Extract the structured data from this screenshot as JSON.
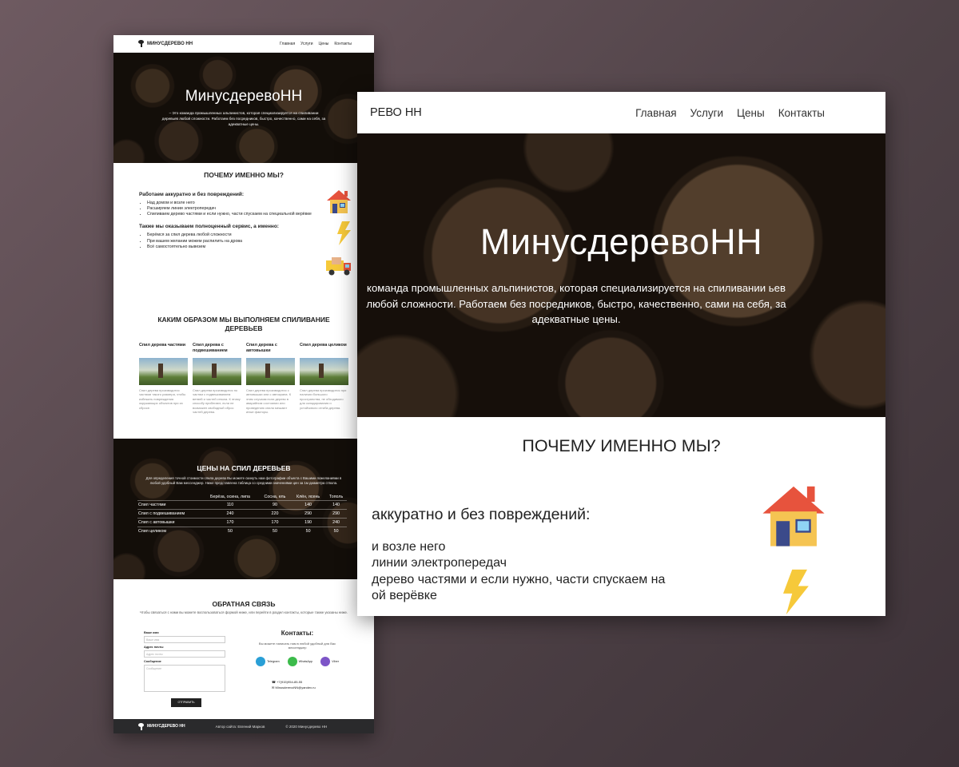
{
  "site": {
    "logo_text": "МИНУСДЕРЕВО НН",
    "nav": [
      "Главная",
      "Услуги",
      "Цены",
      "Контакты"
    ],
    "hero_title": "МинусдеревоНН",
    "hero_text": "– Это команда промышленных альпинистов, которая специализируется на спиливании деревьев любой сложности. Работаем без посредников, быстро, качественно, сами на себя, за адекватные цены."
  },
  "why": {
    "title": "ПОЧЕМУ ИМЕННО МЫ?",
    "block1_title": "Работаем аккуратно и без повреждений:",
    "block1_items": [
      "Над домом и возле него",
      "Расширяем линии электропередач",
      "Спиливаем дерево частями и если нужно, части спускаем на специальной верёвке"
    ],
    "block2_title": "Также мы оказываем полноценный сервис, а именно:",
    "block2_items": [
      "Берёмся за спил дерева любой сложности",
      "При вашем желании можем распилить на дрова",
      "Всё самостоятельно вывезем"
    ],
    "icons": [
      "house-icon",
      "lightning-icon",
      "truck-icon"
    ]
  },
  "how": {
    "title": "КАКИМ ОБРАЗОМ МЫ ВЫПОЛНЯЕМ СПИЛИВАНИЕ ДЕРЕВЬЕВ",
    "cards": [
      {
        "title": "Спил дерева частями",
        "text": "Спил дерева производится частями такого размера, чтобы избежать повреждения окружающих объектов при их сбросе."
      },
      {
        "title": "Спил дерева с подвешиванием",
        "text": "Спил дерева производится по частям с подвешиванием ветвей и частей ствола. К этому способу прибегают, если не возможен свободный сброс частей дерева."
      },
      {
        "title": "Спил дерева с автовышки",
        "text": "Спил дерева производится с автовышки или с автокрана. К этим случаям если дерево в аварийном состоянии или проведению спила мешают иные факторы."
      },
      {
        "title": "Спил дерева целиком",
        "text": "Спил дерева производится при наличии большого пространства, не обходимого для складирования и устойчивого отгиба дерева."
      }
    ]
  },
  "prices": {
    "title": "ЦЕНЫ НА СПИЛ ДЕРЕВЬЕВ",
    "desc": "Для определения точной стоимости спила дерева Вы можете скинуть нам фотографии объекта с Вашими пожеланиями в любой удобный Вам мессенджер. Ниже представлена таблица со средними значениями цен за 1м диаметра ствола.",
    "headers": [
      "",
      "Берёза, осина, липа",
      "Сосна, ель",
      "Клён, ясень",
      "Тополь"
    ],
    "rows": [
      [
        "Спил частями",
        "110",
        "90",
        "140",
        "140"
      ],
      [
        "Спил с подвешиванием",
        "240",
        "220",
        "290",
        "290"
      ],
      [
        "Спил с автовышки",
        "170",
        "170",
        "190",
        "240"
      ],
      [
        "Спил целиком",
        "50",
        "50",
        "50",
        "50"
      ]
    ]
  },
  "feedback": {
    "title": "ОБРАТНАЯ СВЯЗЬ",
    "desc": "Чтобы связаться с нами вы можете воспользоваться формой ниже, или перейти в раздел контакты, которые также указаны ниже.",
    "name_label": "Ваше имя",
    "name_placeholder": "Ваше имя",
    "email_label": "Адрес почты",
    "email_placeholder": "Адрес почты",
    "message_label": "Сообщение",
    "message_placeholder": "Сообщение",
    "submit": "ОТПРАВИТЬ",
    "contacts_title": "Контакты:",
    "contacts_desc": "Вы можете написать нам в любой удобный для Вас мессенджер",
    "messengers": [
      "Telegram",
      "WhatsApp",
      "Viber"
    ],
    "phone": "+7(915)954-85-55",
    "email": "MinusderevoNN@yandex.ru"
  },
  "footer": {
    "logo": "МИНУСДЕРЕВО НН",
    "author": "Автор сайта: Евгений Марков",
    "copyright": "© 2020 Минусдерево НН"
  },
  "zoom": {
    "logo_text_visible": "РЕВО НН",
    "hero_text_visible": "команда промышленных альпинистов, которая специализируется на спиливании ьев любой сложности. Работаем без посредников, быстро, качественно, сами на себя, за адекватные цены.",
    "block1_title_visible": "аккуратно и без повреждений:",
    "block1_items_visible": [
      "и возле него",
      "линии электропередач",
      "дерево частями и если нужно, части спускаем на",
      "ой верёвке"
    ]
  },
  "colors": {
    "background": "#5a4a50",
    "footer": "#2a2a2c",
    "telegram": "#2a9fd6",
    "whatsapp": "#3cbb4b",
    "viber": "#7d55c7"
  }
}
